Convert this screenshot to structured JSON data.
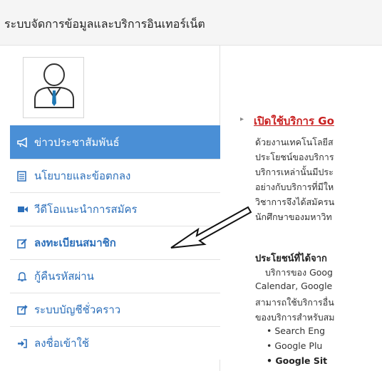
{
  "header": {
    "title": "ระบบจัดการข้อมูลและบริการอินเทอร์เน็ต"
  },
  "sidebar": {
    "items": [
      {
        "label": "ข่าวประชาสัมพันธ์",
        "icon": "megaphone-icon",
        "active": true
      },
      {
        "label": "นโยบายและข้อตกลง",
        "icon": "document-icon",
        "active": false
      },
      {
        "label": "วีดีโอแนะนำการสมัคร",
        "icon": "video-camera-icon",
        "active": false
      },
      {
        "label": "ลงทะเบียนสมาชิก",
        "icon": "edit-icon",
        "active": false
      },
      {
        "label": "กู้คืนรหัสผ่าน",
        "icon": "bell-icon",
        "active": false
      },
      {
        "label": "ระบบบัญชีชั่วคราว",
        "icon": "share-icon",
        "active": false
      },
      {
        "label": "ลงชื่อเข้าใช้",
        "icon": "sign-in-icon",
        "active": false
      }
    ]
  },
  "main": {
    "article_title": "เปิดใช้บริการ Go",
    "intro_lines": [
      "ด้วยงานเทคโนโลยีส",
      "ประโยชน์ของบริการ",
      "บริการเหล่านั้นมีประ",
      "อย่างกับบริการที่มีให",
      "วิชาการจึงได้สมัครน",
      "นักศึกษาของมหาวิท"
    ],
    "section_heading": "ประโยชน์ที่ได้จาก",
    "section_lines": [
      "บริการของ Goog",
      "Calendar, Google",
      "สามารถใช้บริการอื่น",
      "ของบริการสำหรับสม"
    ],
    "list_items": [
      "Search Eng",
      "Google Plu",
      "Google Sit"
    ]
  },
  "colors": {
    "accent": "#4a8fd6",
    "link": "#2c6fba",
    "title_link": "#c82020"
  }
}
